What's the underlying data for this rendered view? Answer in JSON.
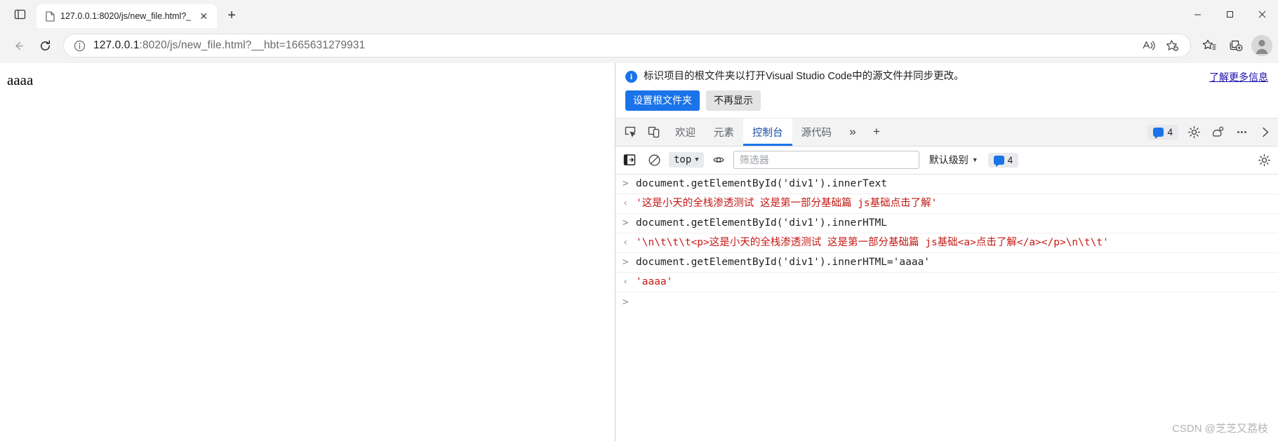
{
  "browser": {
    "tab": {
      "title": "127.0.0.1:8020/js/new_file.html?_",
      "favicon_name": "document-icon",
      "close_label": "✕"
    },
    "new_tab_label": "+",
    "window_controls": {
      "minimize": "—",
      "maximize": "☐",
      "close": "✕"
    },
    "address": {
      "host": "127.0.0.1",
      "path": ":8020/js/new_file.html?__hbt=1665631279931",
      "full_url": "127.0.0.1:8020/js/new_file.html?__hbt=1665631279931",
      "info_icon": "info-circle-icon"
    },
    "toolbar_icons": [
      "read-aloud-icon",
      "add-favorite-icon",
      "favorites-icon",
      "collections-icon",
      "profile-avatar-icon"
    ]
  },
  "page": {
    "body_text": "aaaa"
  },
  "devtools": {
    "notice": {
      "message": "标识项目的根文件夹以打开Visual Studio Code中的源文件并同步更改。",
      "link": "了解更多信息",
      "primary_button": "设置根文件夹",
      "secondary_button": "不再显示",
      "accent_color": "#1a73e8"
    },
    "tabs": [
      {
        "label": "欢迎",
        "active": false
      },
      {
        "label": "元素",
        "active": false
      },
      {
        "label": "控制台",
        "active": true
      },
      {
        "label": "源代码",
        "active": false
      }
    ],
    "tab_more": "»",
    "tab_plus": "+",
    "issue_badge_count": "4",
    "right_icons": [
      "settings-gear-icon",
      "customize-devtools-icon",
      "more-options-icon",
      "close-devtools-icon"
    ],
    "filterbar": {
      "sidebar_toggle": "console-sidebar-icon",
      "clear_console": "clear-console-icon",
      "context_value": "top",
      "eye_icon": "live-expression-icon",
      "filter_placeholder": "筛选器",
      "level_value": "默认级别",
      "issues_count": "4"
    },
    "console_entries": [
      {
        "kind": "input",
        "text": "document.getElementById('div1').innerText"
      },
      {
        "kind": "output",
        "text": "'这是小天的全栈渗透测试 这是第一部分基础篇 js基础点击了解'"
      },
      {
        "kind": "input",
        "text": "document.getElementById('div1').innerHTML"
      },
      {
        "kind": "output",
        "text": "'\\n\\t\\t\\t<p>这是小天的全栈渗透测试 这是第一部分基础篇 js基础<a>点击了解</a></p>\\n\\t\\t'"
      },
      {
        "kind": "input",
        "text": "document.getElementById('div1').innerHTML='aaaa'"
      },
      {
        "kind": "output",
        "text": "'aaaa'"
      }
    ],
    "prompt_symbol": ">",
    "input_chevron": ">",
    "output_chevron": "‹"
  },
  "watermark": "CSDN @芝芝又荔枝"
}
